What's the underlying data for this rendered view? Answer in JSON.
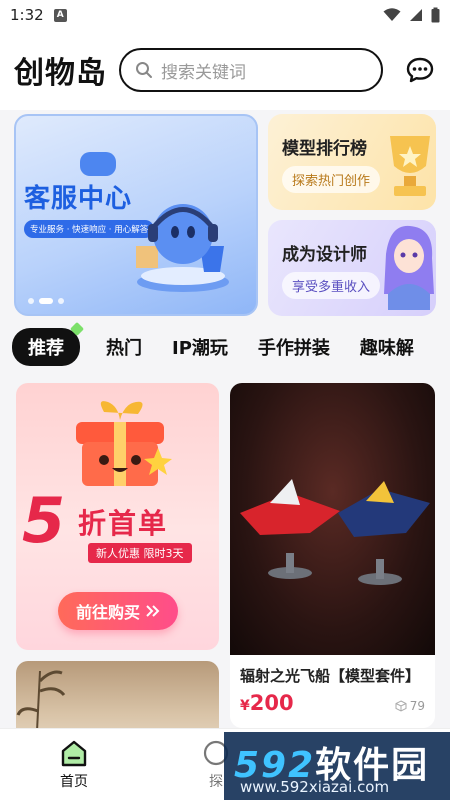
{
  "status": {
    "time": "1:32"
  },
  "header": {
    "logo": "创物岛",
    "search_placeholder": "搜索关键词"
  },
  "banners": {
    "main": {
      "title": "客服中心",
      "subtitle": "专业服务 · 快速响应 · 用心解答"
    },
    "rank": {
      "title": "模型排行榜",
      "button": "探索热门创作"
    },
    "designer": {
      "title": "成为设计师",
      "button": "享受多重收入"
    }
  },
  "tabs": [
    {
      "label": "推荐",
      "active": true
    },
    {
      "label": "热门"
    },
    {
      "label": "IP潮玩"
    },
    {
      "label": "手作拼装"
    },
    {
      "label": "趣味解"
    }
  ],
  "promo": {
    "big_number": "5",
    "main": "折首单",
    "sub": "新人优惠  限时3天",
    "button": "前往购买"
  },
  "product": {
    "name": "辐射之光飞船【模型套件】",
    "currency": "¥",
    "price": "200",
    "views": "79"
  },
  "nav": {
    "home": "首页",
    "explore": "探"
  },
  "watermark": {
    "number": "592",
    "text": "软件园",
    "url": "www.592xiazai.com"
  },
  "colors": {
    "accent_red": "#e6284a",
    "brand_blue": "#1d5fe0",
    "tab_active_bg": "#111111"
  }
}
